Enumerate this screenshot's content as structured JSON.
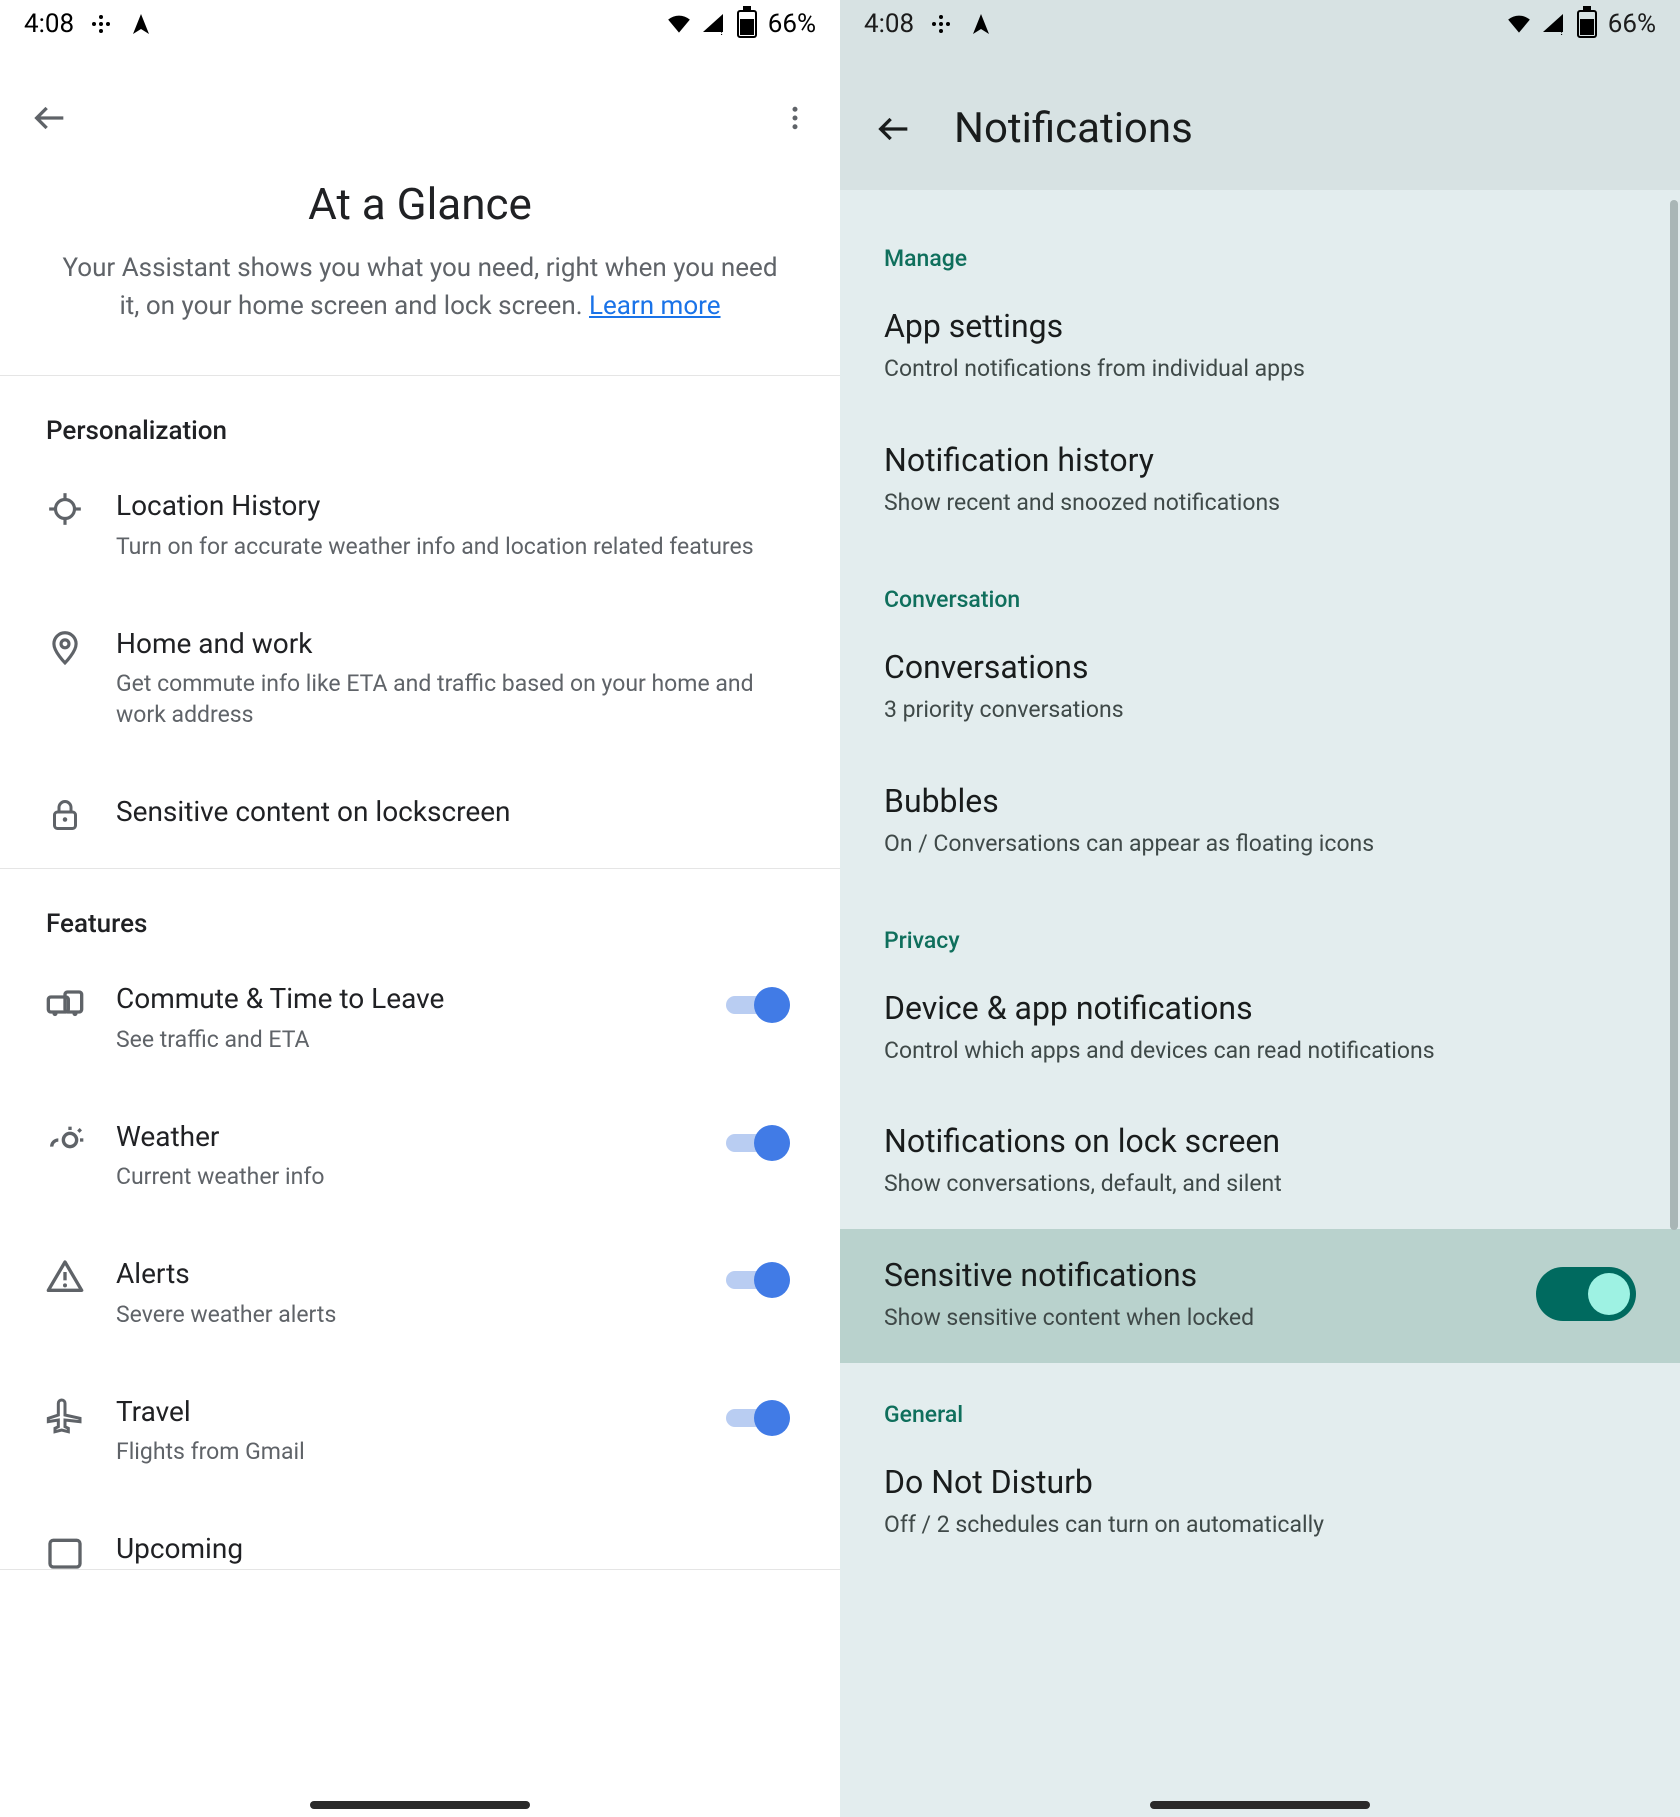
{
  "statusbar": {
    "time": "4:08",
    "battery": "66%"
  },
  "left": {
    "title": "At a Glance",
    "subtitle_pre": "Your Assistant shows you what you need, right when you need it, on your home screen and lock screen. ",
    "subtitle_link": "Learn more",
    "sections": {
      "personalization": {
        "header": "Personalization",
        "items": [
          {
            "title": "Location History",
            "sub": "Turn on for accurate weather info and location related features"
          },
          {
            "title": "Home and work",
            "sub": "Get commute info like ETA and traffic based on your home and work address"
          },
          {
            "title": "Sensitive content on lockscreen",
            "sub": ""
          }
        ]
      },
      "features": {
        "header": "Features",
        "items": [
          {
            "title": "Commute & Time to Leave",
            "sub": "See traffic and ETA"
          },
          {
            "title": "Weather",
            "sub": "Current weather info"
          },
          {
            "title": "Alerts",
            "sub": "Severe weather alerts"
          },
          {
            "title": "Travel",
            "sub": "Flights from Gmail"
          },
          {
            "title": "Upcoming",
            "sub": ""
          }
        ]
      }
    }
  },
  "right": {
    "title": "Notifications",
    "sections": {
      "manage": {
        "label": "Manage",
        "items": [
          {
            "title": "App settings",
            "sub": "Control notifications from individual apps"
          },
          {
            "title": "Notification history",
            "sub": "Show recent and snoozed notifications"
          }
        ]
      },
      "conversation": {
        "label": "Conversation",
        "items": [
          {
            "title": "Conversations",
            "sub": "3 priority conversations"
          },
          {
            "title": "Bubbles",
            "sub": "On / Conversations can appear as floating icons"
          }
        ]
      },
      "privacy": {
        "label": "Privacy",
        "items": [
          {
            "title": "Device & app notifications",
            "sub": "Control which apps and devices can read notifications"
          },
          {
            "title": "Notifications on lock screen",
            "sub": "Show conversations, default, and silent"
          },
          {
            "title": "Sensitive notifications",
            "sub": "Show sensitive content when locked"
          }
        ]
      },
      "general": {
        "label": "General",
        "items": [
          {
            "title": "Do Not Disturb",
            "sub": "Off / 2 schedules can turn on automatically"
          }
        ]
      }
    }
  }
}
